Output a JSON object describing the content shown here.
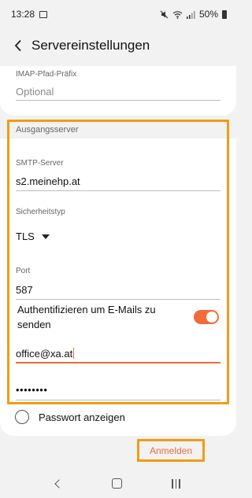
{
  "status_bar": {
    "time": "13:28",
    "battery": "50%",
    "icons": [
      "gallery-icon",
      "mute-icon",
      "wifi-icon",
      "signal-icon",
      "battery-icon"
    ]
  },
  "app_bar": {
    "title": "Servereinstellungen"
  },
  "incoming": {
    "imap_prefix_label": "IMAP-Pfad-Präfix",
    "imap_prefix_placeholder": "Optional"
  },
  "outgoing": {
    "section_title": "Ausgangsserver",
    "smtp_label": "SMTP-Server",
    "smtp_value": "s2.meinehp.at",
    "security_label": "Sicherheitstyp",
    "security_value": "TLS",
    "port_label": "Port",
    "port_value": "587",
    "auth_label": "Authentifizieren um E-Mails zu senden",
    "auth_enabled": true,
    "username_value": "office@xa.at",
    "password_masked": "••••••••"
  },
  "show_password_label": "Passwort anzeigen",
  "login_button": "Anmelden",
  "colors": {
    "accent": "#f26b3a",
    "highlight": "#f39c12",
    "background": "#f2f2f2"
  }
}
